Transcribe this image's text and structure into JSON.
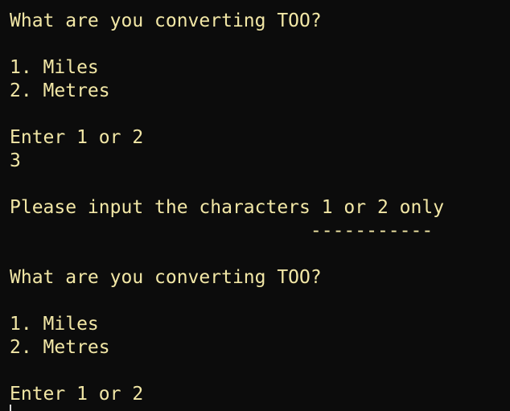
{
  "theme": {
    "background": "#0c0c0c",
    "foreground": "#f2e7a6",
    "cursor": "#d8d8d8"
  },
  "terminal": {
    "lines": [
      "What are you converting TOO?",
      "",
      "1. Miles",
      "2. Metres",
      "",
      "Enter 1 or 2",
      "3",
      "",
      "Please input the characters 1 or 2 only",
      "                           -----------",
      "",
      "What are you converting TOO?",
      "",
      "1. Miles",
      "2. Metres",
      "",
      "Enter 1 or 2"
    ]
  }
}
